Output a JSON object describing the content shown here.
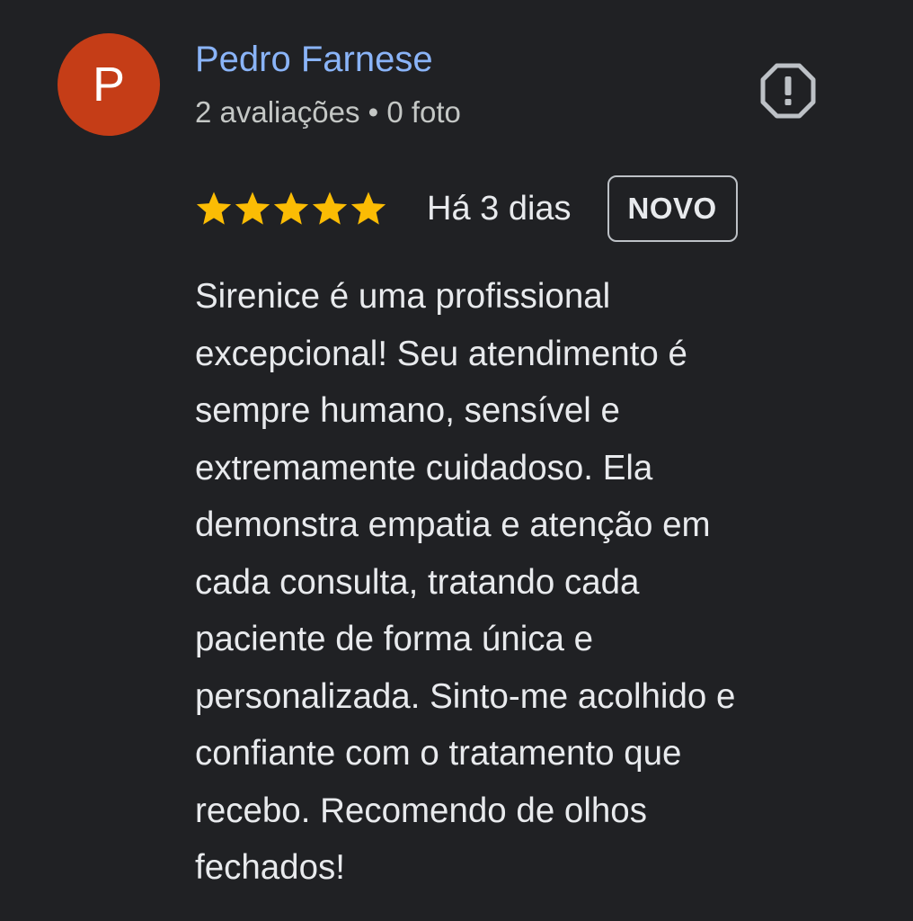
{
  "review": {
    "author": {
      "initial": "P",
      "name": "Pedro Farnese",
      "avatar_color": "#c53d17",
      "name_color": "#8ab4f8"
    },
    "meta": "2 avaliações • 0 foto",
    "flag_icon": "report-flag-icon",
    "rating": {
      "stars": 5,
      "max_stars": 5,
      "star_color": "#fbbc04"
    },
    "date": "Há 3 dias",
    "badge": "NOVO",
    "text_lines": [
      "Sirenice é uma profissional",
      "excepcional! Seu atendimento é",
      "sempre humano, sensível e",
      "extremamente cuidadoso. Ela",
      "demonstra empatia e atenção em",
      "cada consulta, tratando cada",
      "paciente de forma única e",
      "personalizada. Sinto-me acolhido e",
      "confiante com o tratamento que",
      "recebo. Recomendo de olhos",
      "fechados!"
    ]
  }
}
